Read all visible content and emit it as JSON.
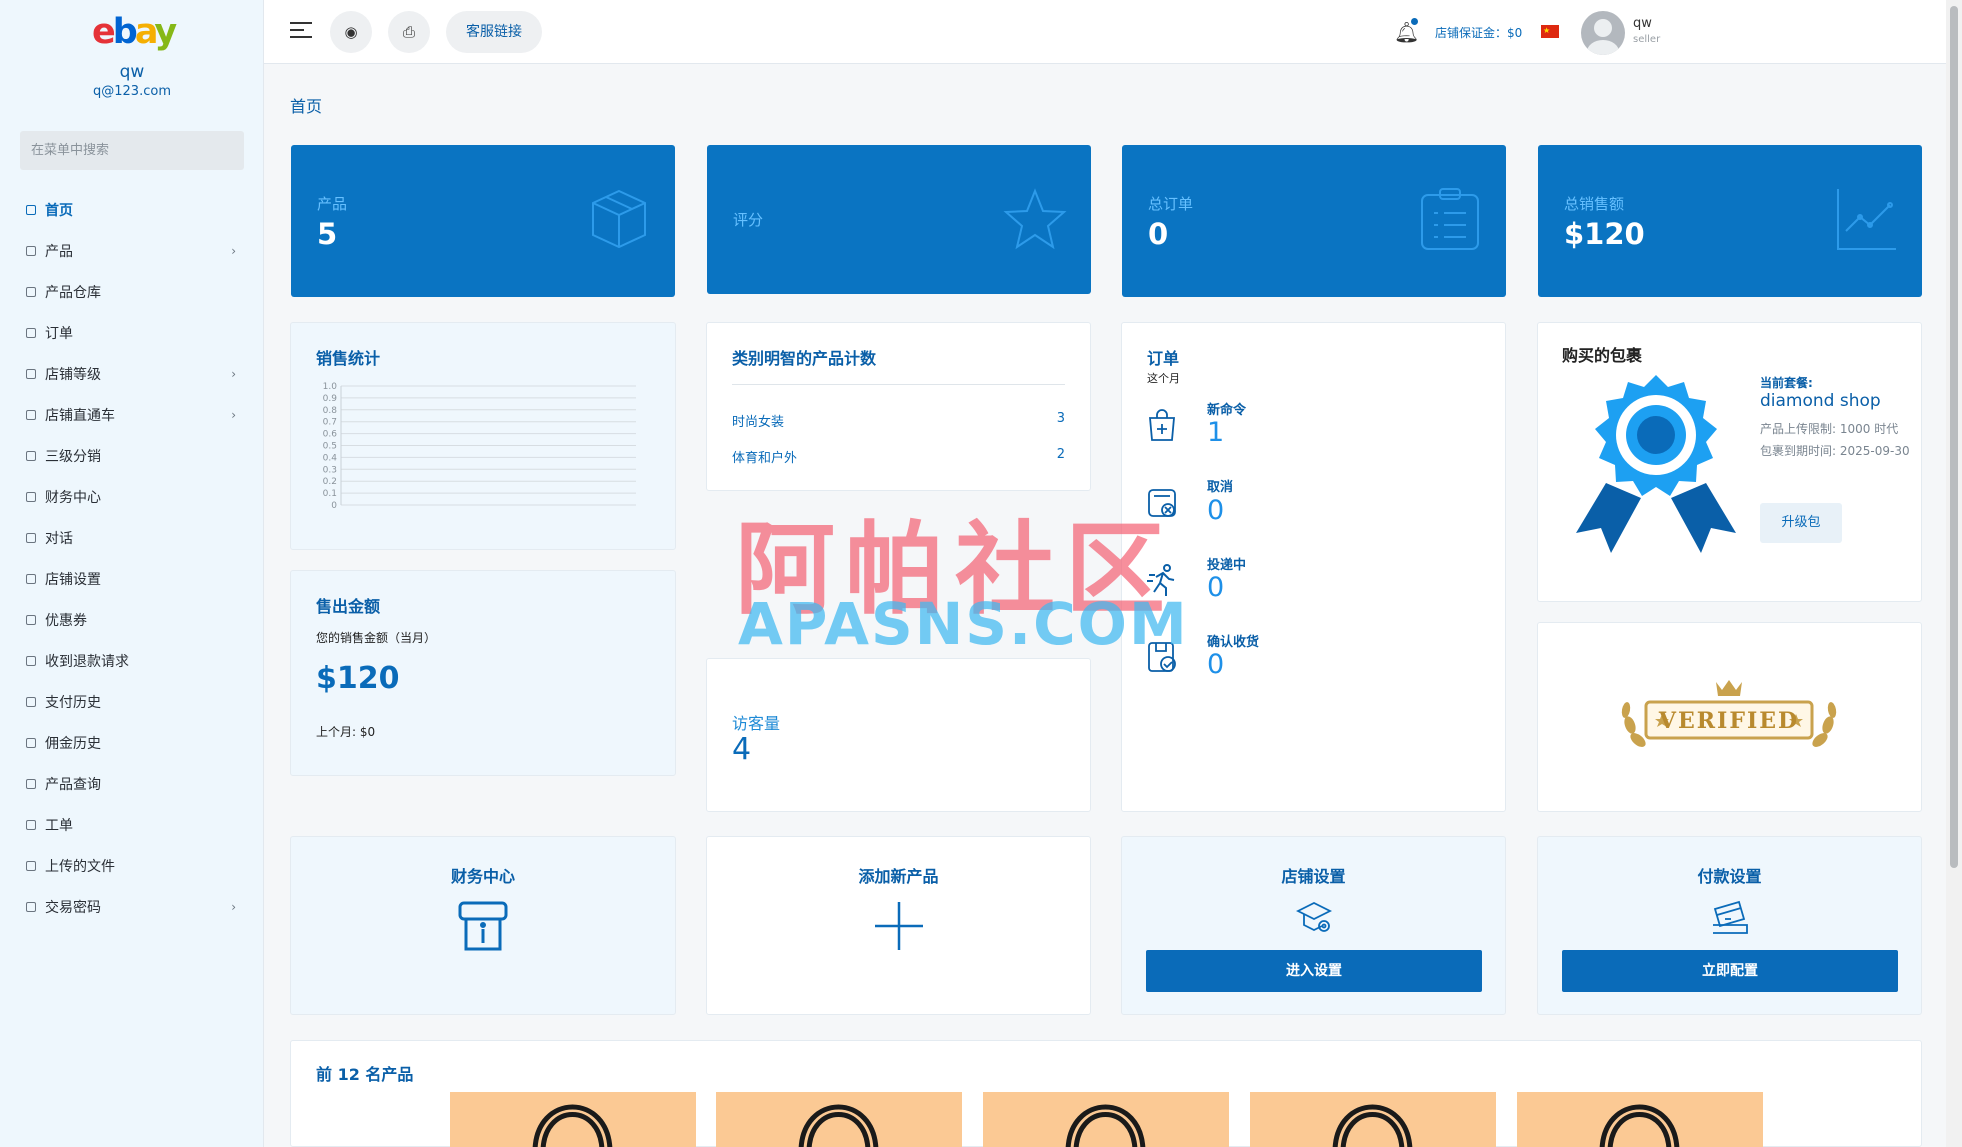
{
  "sidebar": {
    "logo": "ebay",
    "user_name": "qw",
    "user_email": "q@123.com",
    "search_placeholder": "在菜单中搜索",
    "items": [
      {
        "label": "首页",
        "active": true,
        "has_children": false
      },
      {
        "label": "产品",
        "has_children": true
      },
      {
        "label": "产品仓库",
        "has_children": false
      },
      {
        "label": "订单",
        "has_children": false
      },
      {
        "label": "店铺等级",
        "has_children": true
      },
      {
        "label": "店铺直通车",
        "has_children": true
      },
      {
        "label": "三级分销",
        "has_children": false
      },
      {
        "label": "财务中心",
        "has_children": false
      },
      {
        "label": "对话",
        "has_children": false
      },
      {
        "label": "店铺设置",
        "has_children": false
      },
      {
        "label": "优惠券",
        "has_children": false
      },
      {
        "label": "收到退款请求",
        "has_children": false
      },
      {
        "label": "支付历史",
        "has_children": false
      },
      {
        "label": "佣金历史",
        "has_children": false
      },
      {
        "label": "产品查询",
        "has_children": false
      },
      {
        "label": "工单",
        "has_children": false
      },
      {
        "label": "上传的文件",
        "has_children": false
      },
      {
        "label": "交易密码",
        "has_children": true
      }
    ]
  },
  "topbar": {
    "support_link": "客服链接",
    "deposit": "店铺保证金：$0",
    "user_name": "qw",
    "user_role": "seller"
  },
  "breadcrumb": "首页",
  "stats": [
    {
      "label": "产品",
      "value": "5",
      "icon": "box-icon"
    },
    {
      "label": "评分",
      "value": "",
      "icon": "star-icon"
    },
    {
      "label": "总订单",
      "value": "0",
      "icon": "clipboard-icon"
    },
    {
      "label": "总销售额",
      "value": "$120",
      "icon": "trend-icon"
    }
  ],
  "sales_stats": {
    "title": "销售统计",
    "chart_data": {
      "type": "line",
      "title": "",
      "x": [],
      "series": [],
      "yticks": [
        "1.0",
        "0.9",
        "0.8",
        "0.7",
        "0.6",
        "0.5",
        "0.4",
        "0.3",
        "0.2",
        "0.1",
        "0"
      ],
      "ylim": [
        0,
        1
      ],
      "grid": true
    }
  },
  "category_counts": {
    "title": "类别明智的产品计数",
    "rows": [
      {
        "name": "时尚女装",
        "count": "3"
      },
      {
        "name": "体育和户外",
        "count": "2"
      }
    ]
  },
  "orders": {
    "title": "订单",
    "period": "这个月",
    "items": [
      {
        "label": "新命令",
        "value": "1",
        "icon": "bag-plus-icon"
      },
      {
        "label": "取消",
        "value": "0",
        "icon": "cancel-icon"
      },
      {
        "label": "投递中",
        "value": "0",
        "icon": "runner-icon"
      },
      {
        "label": "确认收货",
        "value": "0",
        "icon": "box-check-icon"
      }
    ]
  },
  "package": {
    "title": "购买的包裹",
    "current_label": "当前套餐:",
    "name": "diamond shop",
    "upload_limit": "产品上传限制: 1000 时代",
    "expiry": "包裹到期时间: 2025-09-30",
    "upgrade_button": "升级包"
  },
  "verified_badge": "VERIFIED",
  "sales_amount": {
    "title": "售出金额",
    "subtitle": "您的销售金额（当月）",
    "value": "$120",
    "previous": "上个月: $0"
  },
  "visits": {
    "label": "访客量",
    "value": "4"
  },
  "quick_links": [
    {
      "title": "财务中心",
      "icon": "finance-icon"
    },
    {
      "title": "添加新产品",
      "icon": "plus-icon"
    },
    {
      "title": "店铺设置",
      "icon": "store-settings-icon",
      "button": "进入设置"
    },
    {
      "title": "付款设置",
      "icon": "card-settings-icon",
      "button": "立即配置"
    }
  ],
  "top_products": {
    "title": "前 12 名产品",
    "count_visible": 5
  },
  "watermark": {
    "cn": "阿帕社区",
    "en": "APASNS.COM"
  },
  "colors": {
    "primary": "#0a74c2",
    "primary_dark": "#0a5fa8",
    "sidebar_bg": "#eef7fd",
    "thumb_bg": "#fbc994"
  }
}
